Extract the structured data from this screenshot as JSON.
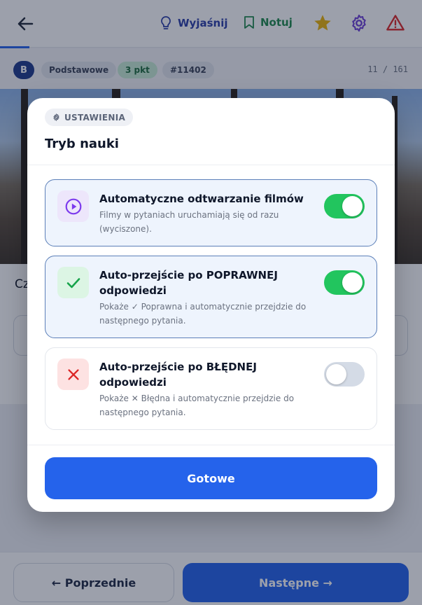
{
  "topbar": {
    "explain_label": "Wyjaśnij",
    "note_label": "Notuj",
    "accent": "#2563eb",
    "icons": [
      "arrow-left-icon",
      "lightbulb-icon",
      "bookmark-icon",
      "star-icon",
      "gear-icon",
      "warning-icon"
    ]
  },
  "meta": {
    "level": "B",
    "category": "Podstawowe",
    "points": "3 pkt",
    "question_id": "#11402",
    "counter": "11 / 161"
  },
  "question": {
    "visible_text": "Cz"
  },
  "footer": {
    "prev_label": "← Poprzednie",
    "next_label": "Następne →"
  },
  "modal": {
    "chip_label": "USTAWIENIA",
    "title": "Tryb nauki",
    "options": [
      {
        "title": "Automatyczne odtwarzanie filmów",
        "description": "Filmy w pytaniach uruchamiają się od razu (wyciszone).",
        "enabled": true,
        "icon": "play-circle-icon"
      },
      {
        "title": "Auto-przejście po POPRAWNEJ odpowiedzi",
        "description": "Pokaże ✓ Poprawna i automatycznie przejdzie do następnego pytania.",
        "enabled": true,
        "icon": "check-icon"
      },
      {
        "title": "Auto-przejście po BŁĘDNEJ odpowiedzi",
        "description": "Pokaże ✕ Błędna i automatycznie przejdzie do następnego pytania.",
        "enabled": false,
        "icon": "x-icon"
      }
    ],
    "done_label": "Gotowe"
  }
}
